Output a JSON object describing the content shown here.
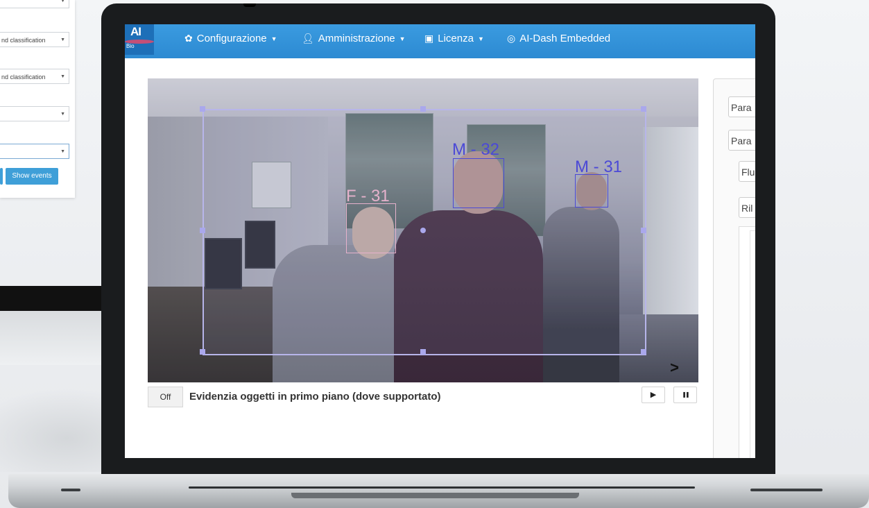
{
  "background": {
    "select_1_text": "",
    "select_2_text": "nd classification",
    "select_3_text": "nd classification",
    "select_4_text": "",
    "select_5_text": "",
    "show_events_label": "Show events"
  },
  "navbar": {
    "logo_text": "AI",
    "logo_sub": "Bio",
    "items": [
      {
        "label": "Configurazione",
        "icon": "gear-icon",
        "dropdown": true
      },
      {
        "label": "Amministrazione",
        "icon": "user-icon",
        "dropdown": true
      },
      {
        "label": "Licenza",
        "icon": "id-card-icon",
        "dropdown": true
      },
      {
        "label": "AI-Dash Embedded",
        "icon": "dashboard-icon",
        "dropdown": false
      }
    ]
  },
  "video": {
    "detections": [
      {
        "label": "M - 32",
        "color": "#4b49d6"
      },
      {
        "label": "M - 31",
        "color": "#4b49d6"
      },
      {
        "label": "F - 31",
        "color": "#e6b2cc"
      }
    ],
    "next_label": ">"
  },
  "controls": {
    "toggle_label": "Off",
    "highlight_text": "Evidenzia oggetti in primo piano (dove supportato)",
    "play_icon": "▶",
    "pause_icon": "❚❚"
  },
  "right_panel": {
    "tabs": [
      "Para",
      "Para",
      "Flu",
      "Ril"
    ]
  },
  "colors": {
    "navbar": "#3393d9",
    "accent": "#3f9fd8"
  }
}
